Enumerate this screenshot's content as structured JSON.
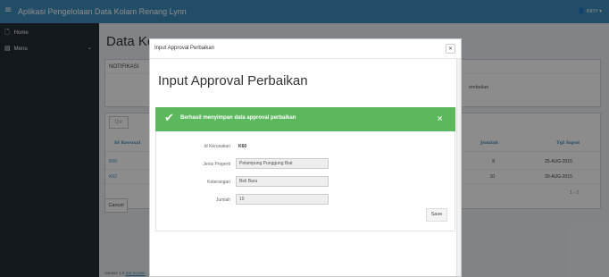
{
  "header": {
    "menu_icon": "hamburger-icon",
    "menu_glyph": "≡",
    "app_title": "Aplikasi Pengelolaan Data Kolam Renang Lynn",
    "user_icon": "user-icon",
    "user_glyph": "👤",
    "user_name": "INDY ▾"
  },
  "sidebar": {
    "items": [
      {
        "label": "Home",
        "icon": "file-icon",
        "glyph": "🗋"
      },
      {
        "label": "Menu",
        "icon": "book-icon",
        "glyph": "▤",
        "chevron": "⌄"
      }
    ]
  },
  "page": {
    "title": "Data Ke",
    "notifications": {
      "heading": "NOTIFIKASI",
      "text": "embelian"
    },
    "search_glyph": "Q∨",
    "table": {
      "headers": [
        "Id Kerusal",
        "Jumlah",
        "Tgl Input"
      ],
      "rows": [
        {
          "id": "K60",
          "jumlah": "8",
          "tgl": "25-AUG-2015"
        },
        {
          "id": "K62",
          "jumlah": "10",
          "tgl": "30-AUG-2015"
        }
      ],
      "pagination": "1 - 2"
    },
    "cancel_label": "Cancel",
    "footer": {
      "prefix": "release 1.0 ",
      "link": "Set Screen"
    }
  },
  "modal": {
    "small_title": "Input Approval Perbaikan",
    "close_glyph": "×",
    "big_title": "Input Approval Perbaikan",
    "alert": {
      "check_glyph": "✔",
      "message": "Berhasil menyimpan data approval perbaikan",
      "close_glyph": "×",
      "color": "#5cb85c"
    },
    "form": {
      "id_label": "Id Kerusakan",
      "id_value": "K60",
      "jenis_label": "Jenis Properti",
      "jenis_value": "Pelampung Punggung Biat",
      "keterangan_label": "Keterangan",
      "keterangan_value": "Beli Baru",
      "jumlah_label": "Jumlah",
      "jumlah_value": "10"
    },
    "save_label": "Save"
  },
  "colors": {
    "header": "#3c8dbc",
    "sidebar": "#222d32",
    "content_bg": "#ecf0f5",
    "success": "#5cb85c"
  }
}
